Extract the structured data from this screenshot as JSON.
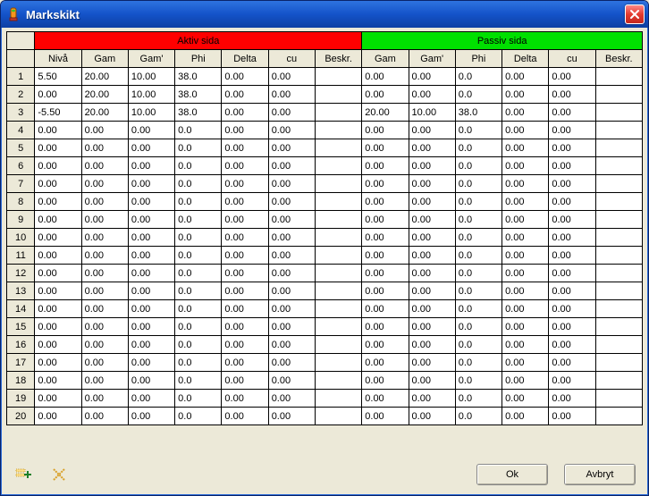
{
  "window": {
    "title": "Markskikt"
  },
  "groups": {
    "active": "Aktiv sida",
    "passive": "Passiv sida"
  },
  "columns": {
    "niva": "Nivå",
    "gam": "Gam",
    "gamp": "Gam'",
    "phi": "Phi",
    "delta": "Delta",
    "cu": "cu",
    "beskr": "Beskr.",
    "p_gam": "Gam",
    "p_gamp": "Gam'",
    "p_phi": "Phi",
    "p_delta": "Delta",
    "p_cu": "cu",
    "p_beskr": "Beskr."
  },
  "rows": [
    {
      "n": "1",
      "niva": "5.50",
      "gam": "20.00",
      "gamp": "10.00",
      "phi": "38.0",
      "delta": "0.00",
      "cu": "0.00",
      "beskr": "",
      "p_gam": "0.00",
      "p_gamp": "0.00",
      "p_phi": "0.0",
      "p_delta": "0.00",
      "p_cu": "0.00",
      "p_beskr": ""
    },
    {
      "n": "2",
      "niva": "0.00",
      "gam": "20.00",
      "gamp": "10.00",
      "phi": "38.0",
      "delta": "0.00",
      "cu": "0.00",
      "beskr": "",
      "p_gam": "0.00",
      "p_gamp": "0.00",
      "p_phi": "0.0",
      "p_delta": "0.00",
      "p_cu": "0.00",
      "p_beskr": ""
    },
    {
      "n": "3",
      "niva": "-5.50",
      "gam": "20.00",
      "gamp": "10.00",
      "phi": "38.0",
      "delta": "0.00",
      "cu": "0.00",
      "beskr": "",
      "p_gam": "20.00",
      "p_gamp": "10.00",
      "p_phi": "38.0",
      "p_delta": "0.00",
      "p_cu": "0.00",
      "p_beskr": ""
    },
    {
      "n": "4",
      "niva": "0.00",
      "gam": "0.00",
      "gamp": "0.00",
      "phi": "0.0",
      "delta": "0.00",
      "cu": "0.00",
      "beskr": "",
      "p_gam": "0.00",
      "p_gamp": "0.00",
      "p_phi": "0.0",
      "p_delta": "0.00",
      "p_cu": "0.00",
      "p_beskr": ""
    },
    {
      "n": "5",
      "niva": "0.00",
      "gam": "0.00",
      "gamp": "0.00",
      "phi": "0.0",
      "delta": "0.00",
      "cu": "0.00",
      "beskr": "",
      "p_gam": "0.00",
      "p_gamp": "0.00",
      "p_phi": "0.0",
      "p_delta": "0.00",
      "p_cu": "0.00",
      "p_beskr": ""
    },
    {
      "n": "6",
      "niva": "0.00",
      "gam": "0.00",
      "gamp": "0.00",
      "phi": "0.0",
      "delta": "0.00",
      "cu": "0.00",
      "beskr": "",
      "p_gam": "0.00",
      "p_gamp": "0.00",
      "p_phi": "0.0",
      "p_delta": "0.00",
      "p_cu": "0.00",
      "p_beskr": ""
    },
    {
      "n": "7",
      "niva": "0.00",
      "gam": "0.00",
      "gamp": "0.00",
      "phi": "0.0",
      "delta": "0.00",
      "cu": "0.00",
      "beskr": "",
      "p_gam": "0.00",
      "p_gamp": "0.00",
      "p_phi": "0.0",
      "p_delta": "0.00",
      "p_cu": "0.00",
      "p_beskr": ""
    },
    {
      "n": "8",
      "niva": "0.00",
      "gam": "0.00",
      "gamp": "0.00",
      "phi": "0.0",
      "delta": "0.00",
      "cu": "0.00",
      "beskr": "",
      "p_gam": "0.00",
      "p_gamp": "0.00",
      "p_phi": "0.0",
      "p_delta": "0.00",
      "p_cu": "0.00",
      "p_beskr": ""
    },
    {
      "n": "9",
      "niva": "0.00",
      "gam": "0.00",
      "gamp": "0.00",
      "phi": "0.0",
      "delta": "0.00",
      "cu": "0.00",
      "beskr": "",
      "p_gam": "0.00",
      "p_gamp": "0.00",
      "p_phi": "0.0",
      "p_delta": "0.00",
      "p_cu": "0.00",
      "p_beskr": ""
    },
    {
      "n": "10",
      "niva": "0.00",
      "gam": "0.00",
      "gamp": "0.00",
      "phi": "0.0",
      "delta": "0.00",
      "cu": "0.00",
      "beskr": "",
      "p_gam": "0.00",
      "p_gamp": "0.00",
      "p_phi": "0.0",
      "p_delta": "0.00",
      "p_cu": "0.00",
      "p_beskr": ""
    },
    {
      "n": "11",
      "niva": "0.00",
      "gam": "0.00",
      "gamp": "0.00",
      "phi": "0.0",
      "delta": "0.00",
      "cu": "0.00",
      "beskr": "",
      "p_gam": "0.00",
      "p_gamp": "0.00",
      "p_phi": "0.0",
      "p_delta": "0.00",
      "p_cu": "0.00",
      "p_beskr": ""
    },
    {
      "n": "12",
      "niva": "0.00",
      "gam": "0.00",
      "gamp": "0.00",
      "phi": "0.0",
      "delta": "0.00",
      "cu": "0.00",
      "beskr": "",
      "p_gam": "0.00",
      "p_gamp": "0.00",
      "p_phi": "0.0",
      "p_delta": "0.00",
      "p_cu": "0.00",
      "p_beskr": ""
    },
    {
      "n": "13",
      "niva": "0.00",
      "gam": "0.00",
      "gamp": "0.00",
      "phi": "0.0",
      "delta": "0.00",
      "cu": "0.00",
      "beskr": "",
      "p_gam": "0.00",
      "p_gamp": "0.00",
      "p_phi": "0.0",
      "p_delta": "0.00",
      "p_cu": "0.00",
      "p_beskr": ""
    },
    {
      "n": "14",
      "niva": "0.00",
      "gam": "0.00",
      "gamp": "0.00",
      "phi": "0.0",
      "delta": "0.00",
      "cu": "0.00",
      "beskr": "",
      "p_gam": "0.00",
      "p_gamp": "0.00",
      "p_phi": "0.0",
      "p_delta": "0.00",
      "p_cu": "0.00",
      "p_beskr": ""
    },
    {
      "n": "15",
      "niva": "0.00",
      "gam": "0.00",
      "gamp": "0.00",
      "phi": "0.0",
      "delta": "0.00",
      "cu": "0.00",
      "beskr": "",
      "p_gam": "0.00",
      "p_gamp": "0.00",
      "p_phi": "0.0",
      "p_delta": "0.00",
      "p_cu": "0.00",
      "p_beskr": ""
    },
    {
      "n": "16",
      "niva": "0.00",
      "gam": "0.00",
      "gamp": "0.00",
      "phi": "0.0",
      "delta": "0.00",
      "cu": "0.00",
      "beskr": "",
      "p_gam": "0.00",
      "p_gamp": "0.00",
      "p_phi": "0.0",
      "p_delta": "0.00",
      "p_cu": "0.00",
      "p_beskr": ""
    },
    {
      "n": "17",
      "niva": "0.00",
      "gam": "0.00",
      "gamp": "0.00",
      "phi": "0.0",
      "delta": "0.00",
      "cu": "0.00",
      "beskr": "",
      "p_gam": "0.00",
      "p_gamp": "0.00",
      "p_phi": "0.0",
      "p_delta": "0.00",
      "p_cu": "0.00",
      "p_beskr": ""
    },
    {
      "n": "18",
      "niva": "0.00",
      "gam": "0.00",
      "gamp": "0.00",
      "phi": "0.0",
      "delta": "0.00",
      "cu": "0.00",
      "beskr": "",
      "p_gam": "0.00",
      "p_gamp": "0.00",
      "p_phi": "0.0",
      "p_delta": "0.00",
      "p_cu": "0.00",
      "p_beskr": ""
    },
    {
      "n": "19",
      "niva": "0.00",
      "gam": "0.00",
      "gamp": "0.00",
      "phi": "0.0",
      "delta": "0.00",
      "cu": "0.00",
      "beskr": "",
      "p_gam": "0.00",
      "p_gamp": "0.00",
      "p_phi": "0.0",
      "p_delta": "0.00",
      "p_cu": "0.00",
      "p_beskr": ""
    },
    {
      "n": "20",
      "niva": "0.00",
      "gam": "0.00",
      "gamp": "0.00",
      "phi": "0.0",
      "delta": "0.00",
      "cu": "0.00",
      "beskr": "",
      "p_gam": "0.00",
      "p_gamp": "0.00",
      "p_phi": "0.0",
      "p_delta": "0.00",
      "p_cu": "0.00",
      "p_beskr": ""
    }
  ],
  "buttons": {
    "ok": "Ok",
    "cancel": "Avbryt"
  }
}
